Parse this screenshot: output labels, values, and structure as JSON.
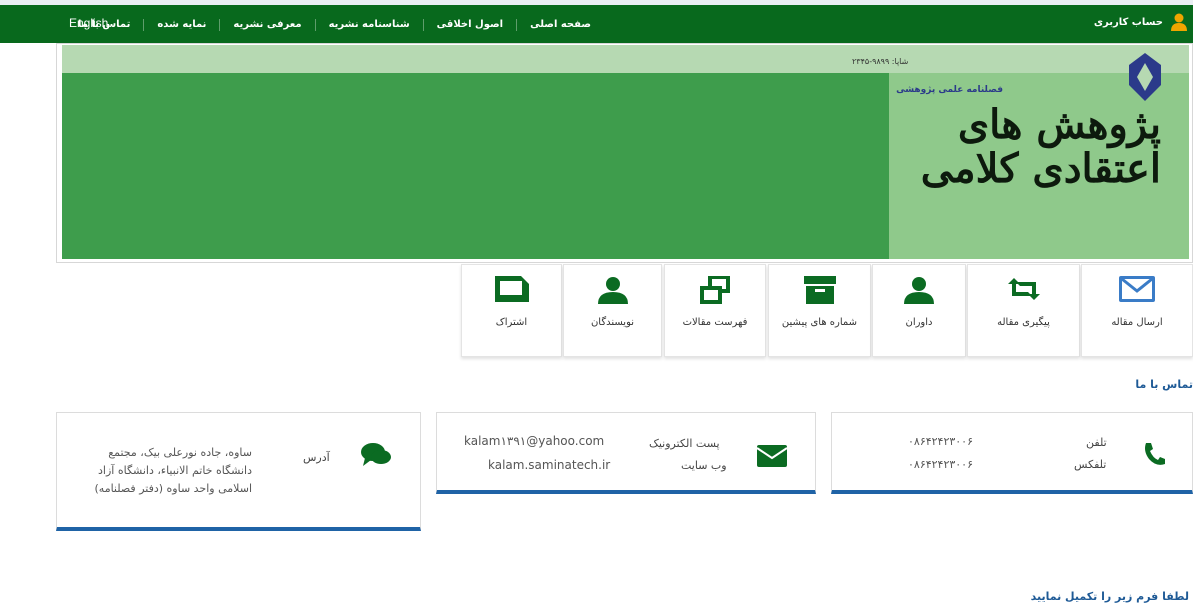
{
  "nav": {
    "english": "English",
    "items": [
      "صفحه اصلی",
      "اصول اخلاقی",
      "شناسنامه نشریه",
      "معرفی نشریه",
      "نمایه شده",
      "تماس با ما"
    ],
    "account": "حساب کاربری"
  },
  "banner": {
    "tag": "فصلنامه علمی  پژوهشی",
    "issn": "شاپا: ۹۸۹۹-۲۳۴۵",
    "title": "پژوهش های اعتقادی کلامی"
  },
  "menu": {
    "items": [
      {
        "label": "ارسال مقاله",
        "icon": "envelope-icon"
      },
      {
        "label": "پیگیری مقاله",
        "icon": "retweet-icon"
      },
      {
        "label": "داوران",
        "icon": "user-icon"
      },
      {
        "label": "شماره های پیشین",
        "icon": "archive-icon"
      },
      {
        "label": "فهرست مقالات",
        "icon": "windows-icon"
      },
      {
        "label": "نویسندگان",
        "icon": "user-icon"
      },
      {
        "label": "اشتراک",
        "icon": "folder-icon"
      }
    ]
  },
  "contact": {
    "heading": "تماس با ما",
    "phone_label": "تلفن",
    "phone": "۰۸۶۴۲۴۲۳۰۰۶",
    "fax_label": "تلفکس",
    "fax": "۰۸۶۴۲۴۲۳۰۰۶",
    "email_label": "پست الکترونیک",
    "email": "kalam۱۳۹۱@yahoo.com",
    "website_label": "وب سایت",
    "website": "kalam.saminatech.ir",
    "address_label": "آدرس",
    "address": "ساوه، جاده نورعلی بیک، مجتمع دانشگاه خاتم الانبیاء، دانشگاه آزاد اسلامی واحد ساوه (دفتر فصلنامه)"
  },
  "form_note": "لطفا فرم زیر را تکمیل نمایید",
  "colors": {
    "nav": "#08691d",
    "icon": "#0b6b22",
    "accent": "#1f63a6"
  }
}
